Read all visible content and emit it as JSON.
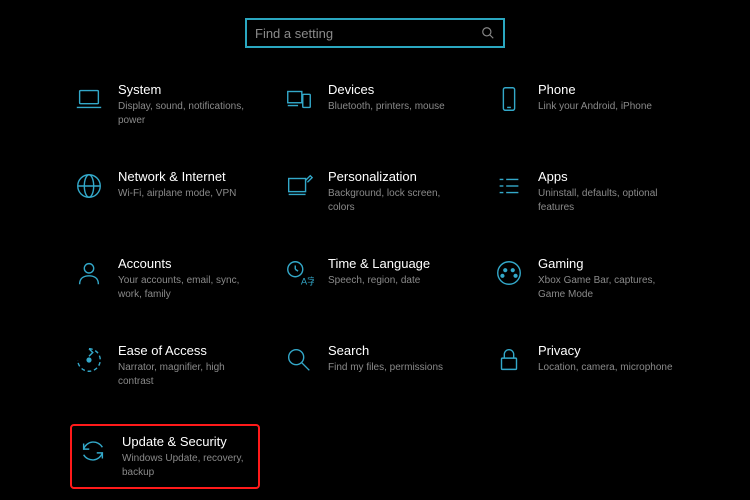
{
  "search": {
    "placeholder": "Find a setting"
  },
  "categories": [
    {
      "id": "system",
      "icon": "laptop-icon",
      "title": "System",
      "desc": "Display, sound, notifications, power"
    },
    {
      "id": "devices",
      "icon": "devices-icon",
      "title": "Devices",
      "desc": "Bluetooth, printers, mouse"
    },
    {
      "id": "phone",
      "icon": "phone-icon",
      "title": "Phone",
      "desc": "Link your Android, iPhone"
    },
    {
      "id": "network",
      "icon": "globe-icon",
      "title": "Network & Internet",
      "desc": "Wi-Fi, airplane mode, VPN"
    },
    {
      "id": "personalization",
      "icon": "paint-icon",
      "title": "Personalization",
      "desc": "Background, lock screen, colors"
    },
    {
      "id": "apps",
      "icon": "apps-icon",
      "title": "Apps",
      "desc": "Uninstall, defaults, optional features"
    },
    {
      "id": "accounts",
      "icon": "person-icon",
      "title": "Accounts",
      "desc": "Your accounts, email, sync, work, family"
    },
    {
      "id": "time-language",
      "icon": "time-lang-icon",
      "title": "Time & Language",
      "desc": "Speech, region, date"
    },
    {
      "id": "gaming",
      "icon": "gaming-icon",
      "title": "Gaming",
      "desc": "Xbox Game Bar, captures, Game Mode"
    },
    {
      "id": "ease-of-access",
      "icon": "ease-icon",
      "title": "Ease of Access",
      "desc": "Narrator, magnifier, high contrast"
    },
    {
      "id": "search",
      "icon": "magnify-icon",
      "title": "Search",
      "desc": "Find my files, permissions"
    },
    {
      "id": "privacy",
      "icon": "lock-icon",
      "title": "Privacy",
      "desc": "Location, camera, microphone"
    },
    {
      "id": "update-security",
      "icon": "update-icon",
      "title": "Update & Security",
      "desc": "Windows Update, recovery, backup",
      "highlighted": true
    }
  ]
}
